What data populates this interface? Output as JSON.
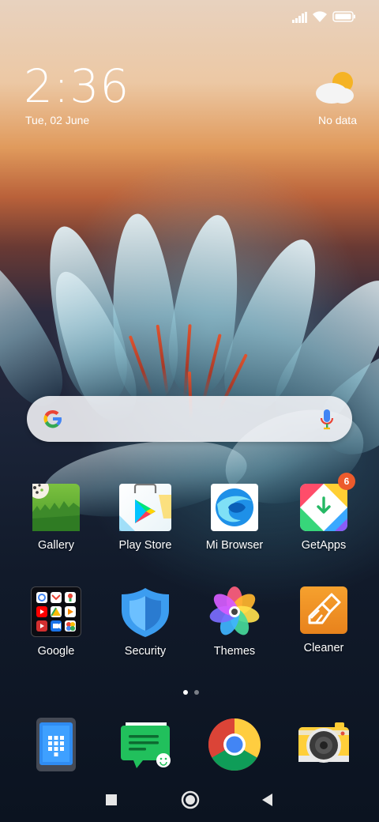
{
  "status": {
    "signal_icon": "cell-signal-icon",
    "wifi_icon": "wifi-icon",
    "battery_icon": "battery-icon"
  },
  "clock": {
    "time": "2:36",
    "date": "Tue, 02 June"
  },
  "weather": {
    "icon": "partly-cloudy-icon",
    "text": "No data"
  },
  "search": {
    "logo": "google-g-icon",
    "mic_icon": "mic-icon"
  },
  "apps_row1": [
    {
      "label": "Gallery"
    },
    {
      "label": "Play Store"
    },
    {
      "label": "Mi Browser"
    },
    {
      "label": "GetApps",
      "badge": "6"
    }
  ],
  "apps_row2": [
    {
      "label": "Google"
    },
    {
      "label": "Security"
    },
    {
      "label": "Themes"
    },
    {
      "label": "Cleaner"
    }
  ],
  "page_indicator": {
    "pages": 2,
    "current": 1
  },
  "dock": [
    {
      "name": "Phone"
    },
    {
      "name": "Messages"
    },
    {
      "name": "Chrome"
    },
    {
      "name": "Camera"
    }
  ],
  "navbar": {
    "recents_icon": "square-icon",
    "home_icon": "circle-icon",
    "back_icon": "triangle-back-icon"
  },
  "colors": {
    "badge": "#ec5b2c",
    "accent_orange": "#e88a24"
  }
}
